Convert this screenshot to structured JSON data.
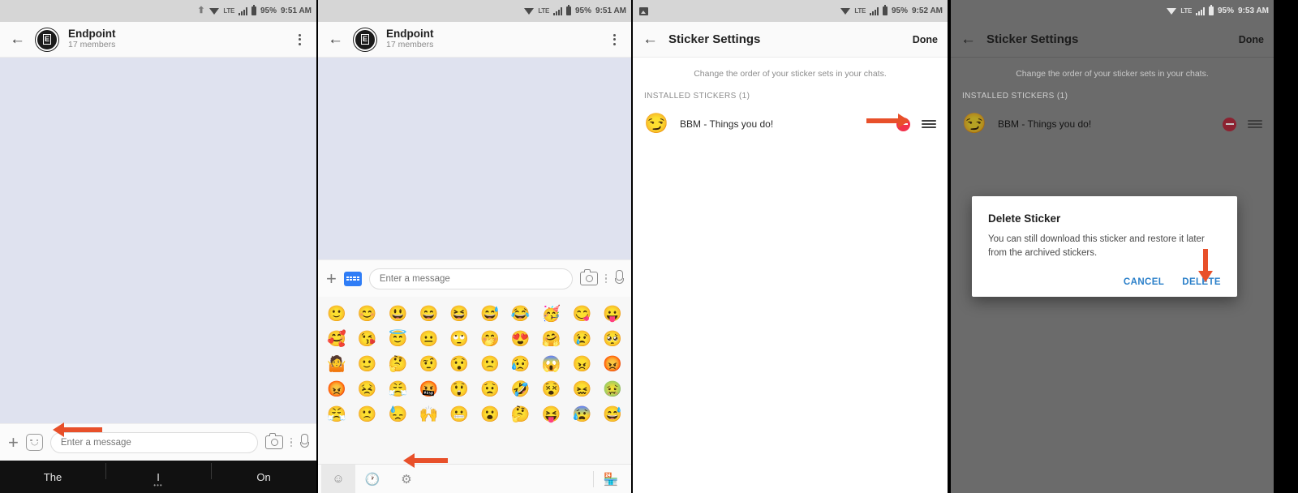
{
  "panels": [
    {
      "id": "chat-initial",
      "statusbar": {
        "icons": [
          "upload-icon",
          "wifi-icon",
          "lte-icon",
          "signal-icon",
          "battery-icon"
        ],
        "lte": "LTE",
        "battery": "95%",
        "time": "9:51 AM"
      },
      "appbar": {
        "back": "←",
        "avatar_letter": "E",
        "title": "Endpoint",
        "subtitle": "17 members",
        "menu": "⋮"
      },
      "composer": {
        "plus": "+",
        "placeholder": "Enter a message",
        "value": ""
      },
      "suggestions": [
        "The",
        "I",
        "On"
      ]
    },
    {
      "id": "chat-emoji-open",
      "statusbar": {
        "icons": [
          "wifi-icon",
          "lte-icon",
          "signal-icon",
          "battery-icon"
        ],
        "lte": "LTE",
        "battery": "95%",
        "time": "9:51 AM"
      },
      "appbar": {
        "back": "←",
        "avatar_letter": "E",
        "title": "Endpoint",
        "subtitle": "17 members",
        "menu": "⋮"
      },
      "composer": {
        "plus": "+",
        "placeholder": "Enter a message",
        "value": ""
      },
      "emoji_rows": [
        [
          "🙂",
          "😊",
          "😃",
          "😄",
          "😆",
          "😅",
          "😂",
          "🥳",
          "😋",
          "😛"
        ],
        [
          "🥰",
          "😘",
          "😇",
          "😐",
          "🙄",
          "🤭",
          "😍",
          "🤗",
          "😢",
          "🥺"
        ],
        [
          "🤷",
          "🙂",
          "🤔",
          "🤨",
          "😯",
          "🙁",
          "😥",
          "😱",
          "😠",
          "😡"
        ],
        [
          "😡",
          "😣",
          "😤",
          "🤬",
          "😲",
          "😟",
          "🤣",
          "😵",
          "😖",
          "🤢"
        ],
        [
          "😤",
          "🙁",
          "😓",
          "🙌",
          "😬",
          "😮",
          "🤔",
          "😝",
          "😰",
          "😅"
        ]
      ],
      "emoji_tabs": [
        "smiley-tab",
        "recent-tab",
        "settings-tab",
        "store-tab"
      ]
    },
    {
      "id": "sticker-settings",
      "statusbar": {
        "icons": [
          "image-icon",
          "wifi-icon",
          "lte-icon",
          "signal-icon",
          "battery-icon"
        ],
        "lte": "LTE",
        "battery": "95%",
        "time": "9:52 AM"
      },
      "appbar": {
        "back": "←",
        "title": "Sticker Settings",
        "action": "Done"
      },
      "hint": "Change the order of your sticker sets in your chats.",
      "section_label": "INSTALLED STICKERS (1)",
      "stickers": [
        {
          "thumb": "😏",
          "name": "BBM - Things you do!"
        }
      ]
    },
    {
      "id": "sticker-settings-delete-dialog",
      "statusbar": {
        "icons": [
          "wifi-icon",
          "lte-icon",
          "signal-icon",
          "battery-icon"
        ],
        "lte": "LTE",
        "battery": "95%",
        "time": "9:53 AM"
      },
      "appbar": {
        "back": "←",
        "title": "Sticker Settings",
        "action": "Done"
      },
      "hint": "Change the order of your sticker sets in your chats.",
      "section_label": "INSTALLED STICKERS (1)",
      "stickers": [
        {
          "thumb": "😏",
          "name": "BBM - Things you do!"
        }
      ],
      "dialog": {
        "title": "Delete Sticker",
        "body": "You can still download this sticker and restore it later from the archived stickers.",
        "cancel": "CANCEL",
        "confirm": "DELETE"
      }
    }
  ],
  "colors": {
    "annotation": "#e8502a",
    "remove": "#f2324c",
    "link": "#2a7fc9",
    "chat_bg": "#dfe2ef",
    "keyboard_blue": "#2f7df6"
  }
}
